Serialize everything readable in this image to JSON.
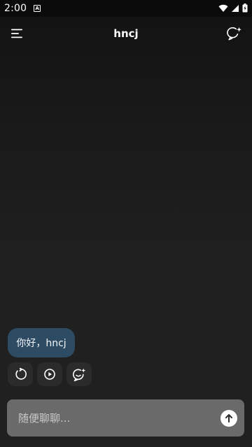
{
  "status_bar": {
    "time": "2:00",
    "app_icon": "A"
  },
  "header": {
    "title": "hncj",
    "menu_icon": "menu-icon",
    "new_chat_icon": "new-chat-sparkle-icon"
  },
  "message": {
    "text": "你好，hncj"
  },
  "actions": [
    {
      "icon": "refresh-icon"
    },
    {
      "icon": "play-circle-icon"
    },
    {
      "icon": "smile-sparkle-icon"
    }
  ],
  "input": {
    "placeholder": "随便聊聊..."
  },
  "colors": {
    "bubble": "#2d4b63",
    "input_bg": "#6a6a6a",
    "background": "#1f1f1f"
  }
}
